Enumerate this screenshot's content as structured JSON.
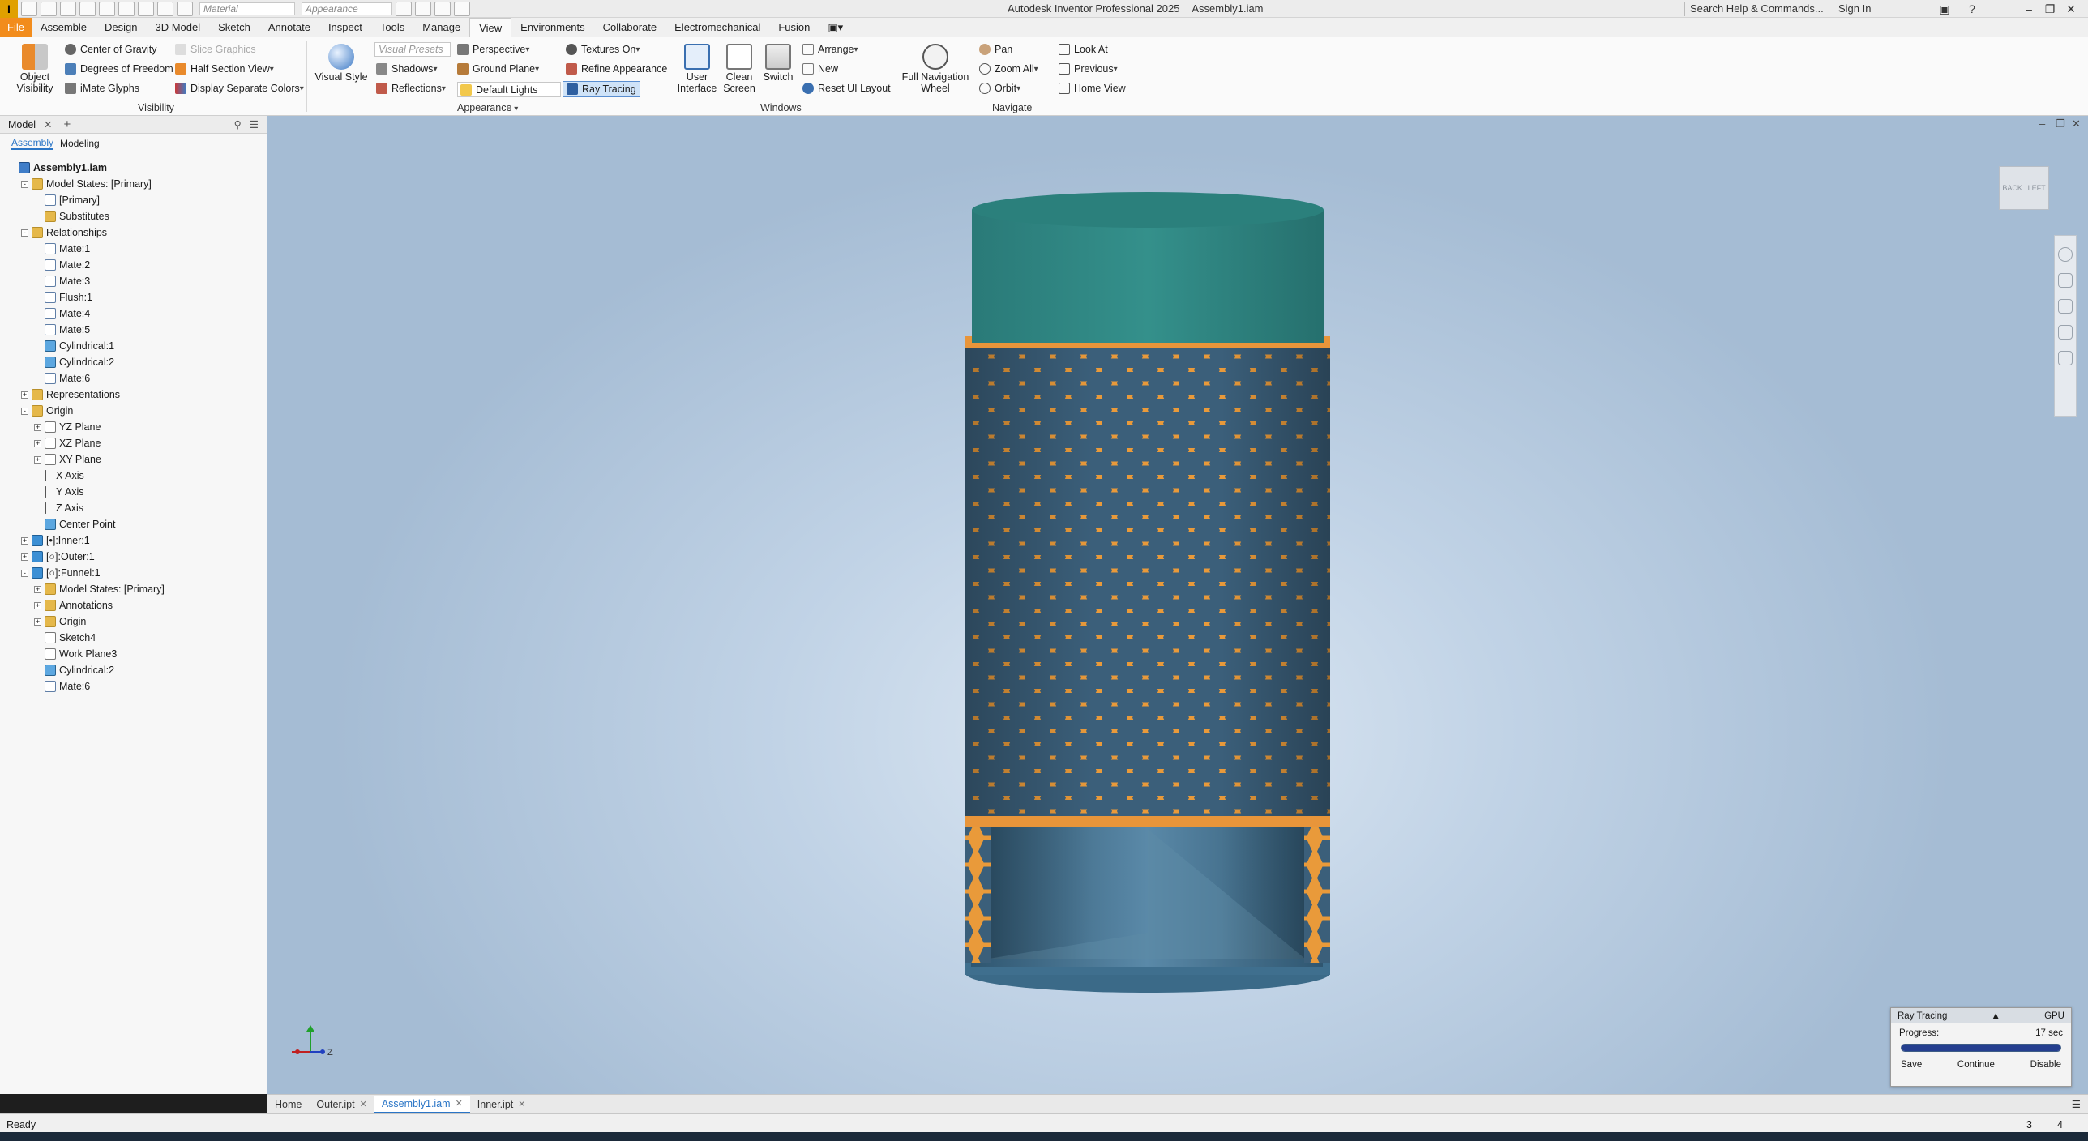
{
  "titlebar": {
    "app_icon": "I",
    "material_placeholder": "Material",
    "appearance_placeholder": "Appearance",
    "product": "Autodesk Inventor Professional 2025",
    "document": "Assembly1.iam",
    "search_placeholder": "Search Help & Commands...",
    "sign_in": "Sign In"
  },
  "tabs": [
    "File",
    "Assemble",
    "Design",
    "3D Model",
    "Sketch",
    "Annotate",
    "Inspect",
    "Tools",
    "Manage",
    "View",
    "Environments",
    "Collaborate",
    "Electromechanical",
    "Fusion"
  ],
  "active_tab": "View",
  "ribbon": {
    "visibility": {
      "object_visibility": "Object\nVisibility",
      "center_of_gravity": "Center of Gravity",
      "degrees_of_freedom": "Degrees of Freedom",
      "imate_glyphs": "iMate Glyphs",
      "slice_graphics": "Slice Graphics",
      "half_section_view": "Half Section View",
      "display_separate_colors": "Display Separate Colors",
      "label": "Visibility"
    },
    "appearance": {
      "visual_style": "Visual Style",
      "visual_presets": "Visual Presets",
      "shadows": "Shadows",
      "reflections": "Reflections",
      "perspective": "Perspective",
      "ground_plane": "Ground Plane",
      "default_lights": "Default Lights",
      "textures_on": "Textures On",
      "refine_appearance": "Refine Appearance",
      "ray_tracing": "Ray Tracing",
      "label": "Appearance"
    },
    "windows": {
      "user_interface": "User\nInterface",
      "clean_screen": "Clean\nScreen",
      "switch": "Switch",
      "arrange": "Arrange",
      "new": "New",
      "reset_ui_layout": "Reset UI Layout",
      "label": "Windows"
    },
    "navigate": {
      "full_navigation_wheel": "Full Navigation\nWheel",
      "pan": "Pan",
      "zoom_all": "Zoom All",
      "orbit": "Orbit",
      "look_at": "Look At",
      "previous": "Previous",
      "home_view": "Home View",
      "label": "Navigate"
    }
  },
  "browser": {
    "tab": "Model",
    "subtabs": [
      "Assembly",
      "Modeling"
    ],
    "tree": [
      {
        "label": "Assembly1.iam",
        "level": 0,
        "icon": "assembly-icon",
        "bold": true
      },
      {
        "label": "Model States: [Primary]",
        "level": 1,
        "icon": "folder-icon",
        "exp": "-"
      },
      {
        "label": "[Primary]",
        "level": 2,
        "icon": "model-state-icon"
      },
      {
        "label": "Substitutes",
        "level": 2,
        "icon": "folder-icon"
      },
      {
        "label": "Relationships",
        "level": 1,
        "icon": "folder-icon",
        "exp": "-"
      },
      {
        "label": "Mate:1",
        "level": 2,
        "icon": "mate-icon"
      },
      {
        "label": "Mate:2",
        "level": 2,
        "icon": "mate-icon"
      },
      {
        "label": "Mate:3",
        "level": 2,
        "icon": "mate-icon"
      },
      {
        "label": "Flush:1",
        "level": 2,
        "icon": "mate-icon"
      },
      {
        "label": "Mate:4",
        "level": 2,
        "icon": "mate-icon"
      },
      {
        "label": "Mate:5",
        "level": 2,
        "icon": "mate-icon"
      },
      {
        "label": "Cylindrical:1",
        "level": 2,
        "icon": "cylindrical-icon"
      },
      {
        "label": "Cylindrical:2",
        "level": 2,
        "icon": "cylindrical-icon"
      },
      {
        "label": "Mate:6",
        "level": 2,
        "icon": "mate-icon"
      },
      {
        "label": "Representations",
        "level": 1,
        "icon": "folder-icon",
        "exp": "+"
      },
      {
        "label": "Origin",
        "level": 1,
        "icon": "folder-icon",
        "exp": "-"
      },
      {
        "label": "YZ Plane",
        "level": 2,
        "icon": "plane-icon",
        "exp": "+"
      },
      {
        "label": "XZ Plane",
        "level": 2,
        "icon": "plane-icon",
        "exp": "+"
      },
      {
        "label": "XY Plane",
        "level": 2,
        "icon": "plane-icon",
        "exp": "+"
      },
      {
        "label": "X Axis",
        "level": 2,
        "icon": "axis-icon"
      },
      {
        "label": "Y Axis",
        "level": 2,
        "icon": "axis-icon"
      },
      {
        "label": "Z Axis",
        "level": 2,
        "icon": "axis-icon"
      },
      {
        "label": "Center Point",
        "level": 2,
        "icon": "point-icon"
      },
      {
        "label": "[•]:Inner:1",
        "level": 1,
        "icon": "part-icon",
        "exp": "+"
      },
      {
        "label": "[○]:Outer:1",
        "level": 1,
        "icon": "part-icon",
        "exp": "+"
      },
      {
        "label": "[○]:Funnel:1",
        "level": 1,
        "icon": "part-icon",
        "exp": "-"
      },
      {
        "label": "Model States: [Primary]",
        "level": 2,
        "icon": "folder-icon",
        "exp": "+"
      },
      {
        "label": "Annotations",
        "level": 2,
        "icon": "folder-icon",
        "exp": "+"
      },
      {
        "label": "Origin",
        "level": 2,
        "icon": "folder-icon",
        "exp": "+"
      },
      {
        "label": "Sketch4",
        "level": 2,
        "icon": "sketch-icon"
      },
      {
        "label": "Work Plane3",
        "level": 2,
        "icon": "plane-icon"
      },
      {
        "label": "Cylindrical:2",
        "level": 2,
        "icon": "cylindrical-icon"
      },
      {
        "label": "Mate:6",
        "level": 2,
        "icon": "mate-icon"
      }
    ]
  },
  "viewcube": {
    "back": "BACK",
    "left": "LEFT"
  },
  "triad": {
    "y": "",
    "z": "Z"
  },
  "ray_tracing": {
    "title": "Ray Tracing",
    "mode": "GPU",
    "progress_label": "Progress:",
    "time": "17 sec",
    "progress_fraction": 1.0,
    "save": "Save",
    "continue": "Continue",
    "disable": "Disable"
  },
  "doc_tabs": [
    {
      "label": "Home",
      "active": false,
      "closable": false
    },
    {
      "label": "Outer.ipt",
      "active": false,
      "closable": true
    },
    {
      "label": "Assembly1.iam",
      "active": true,
      "closable": true
    },
    {
      "label": "Inner.ipt",
      "active": false,
      "closable": true
    }
  ],
  "status": {
    "text": "Ready",
    "count1": "3",
    "count2": "4"
  },
  "colors": {
    "accent": "#2a75c6",
    "file_tab": "#f28c1c",
    "lattice": "#e99a3a",
    "cap": "#2f8580",
    "inner": "#3f6e8c"
  }
}
